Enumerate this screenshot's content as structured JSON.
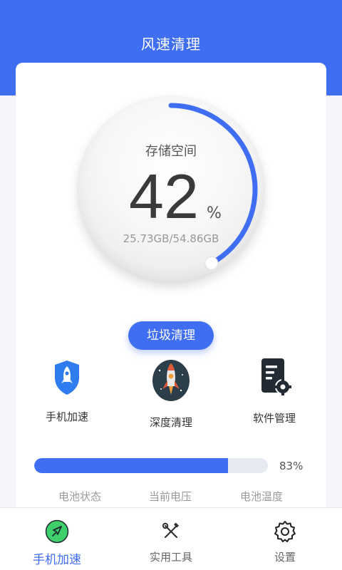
{
  "header": {
    "title": "风速清理"
  },
  "storage": {
    "label": "存储空间",
    "percent": "42",
    "percent_value": 42,
    "unit": "%",
    "detail": "25.73GB/54.86GB"
  },
  "clean_button": {
    "label": "垃圾清理"
  },
  "features": [
    {
      "label": "手机加速",
      "icon": "shield-rocket-icon"
    },
    {
      "label": "深度清理",
      "icon": "rocket-icon"
    },
    {
      "label": "软件管理",
      "icon": "document-gear-icon"
    }
  ],
  "battery": {
    "progress_percent": 83,
    "progress_text": "83%",
    "stats": [
      {
        "label": "电池状态"
      },
      {
        "label": "当前电压"
      },
      {
        "label": "电池温度"
      }
    ]
  },
  "bottom_nav": {
    "items": [
      {
        "label": "手机加速",
        "icon": "rocket-circle-icon",
        "active": true
      },
      {
        "label": "实用工具",
        "icon": "tools-icon",
        "active": false
      },
      {
        "label": "设置",
        "icon": "gear-icon",
        "active": false
      }
    ]
  },
  "colors": {
    "accent": "#3f6ef2",
    "accent_green": "#3fcf6a"
  }
}
